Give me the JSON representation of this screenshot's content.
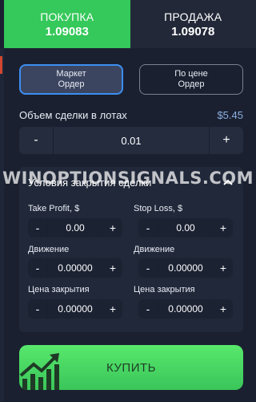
{
  "tabs": [
    {
      "label": "ПОКУПКА",
      "price": "1.09083"
    },
    {
      "label": "ПРОДАЖА",
      "price": "1.09078"
    }
  ],
  "order_types": [
    {
      "label": "Маркет Ордер",
      "active": true
    },
    {
      "label": "По цене Ордер",
      "active": false
    }
  ],
  "lot": {
    "label": "Объем сделки в лотах",
    "price": "$5.45",
    "value": "0.01",
    "minus": "-",
    "plus": "+"
  },
  "close_conditions": {
    "title": "Условия закрытия сделки",
    "fields": [
      {
        "label": "Take Profit, $",
        "value": "0.00"
      },
      {
        "label": "Stop Loss, $",
        "value": "0.00"
      },
      {
        "label": "Движение",
        "value": "0.00000"
      },
      {
        "label": "Движение",
        "value": "0.00000"
      },
      {
        "label": "Цена закрытия",
        "value": "0.00000"
      },
      {
        "label": "Цена закрытия",
        "value": "0.00000"
      }
    ],
    "minus": "-",
    "plus": "+"
  },
  "watermark": "WINOPTIONSIGNALS.COM",
  "buy_button": {
    "label": "КУПИТЬ",
    "icon": "trend-up-chart-icon"
  },
  "colors": {
    "buy_green": "#35c85a",
    "accent_blue": "#3d8ef0",
    "panel_bg": "#1b2030"
  }
}
